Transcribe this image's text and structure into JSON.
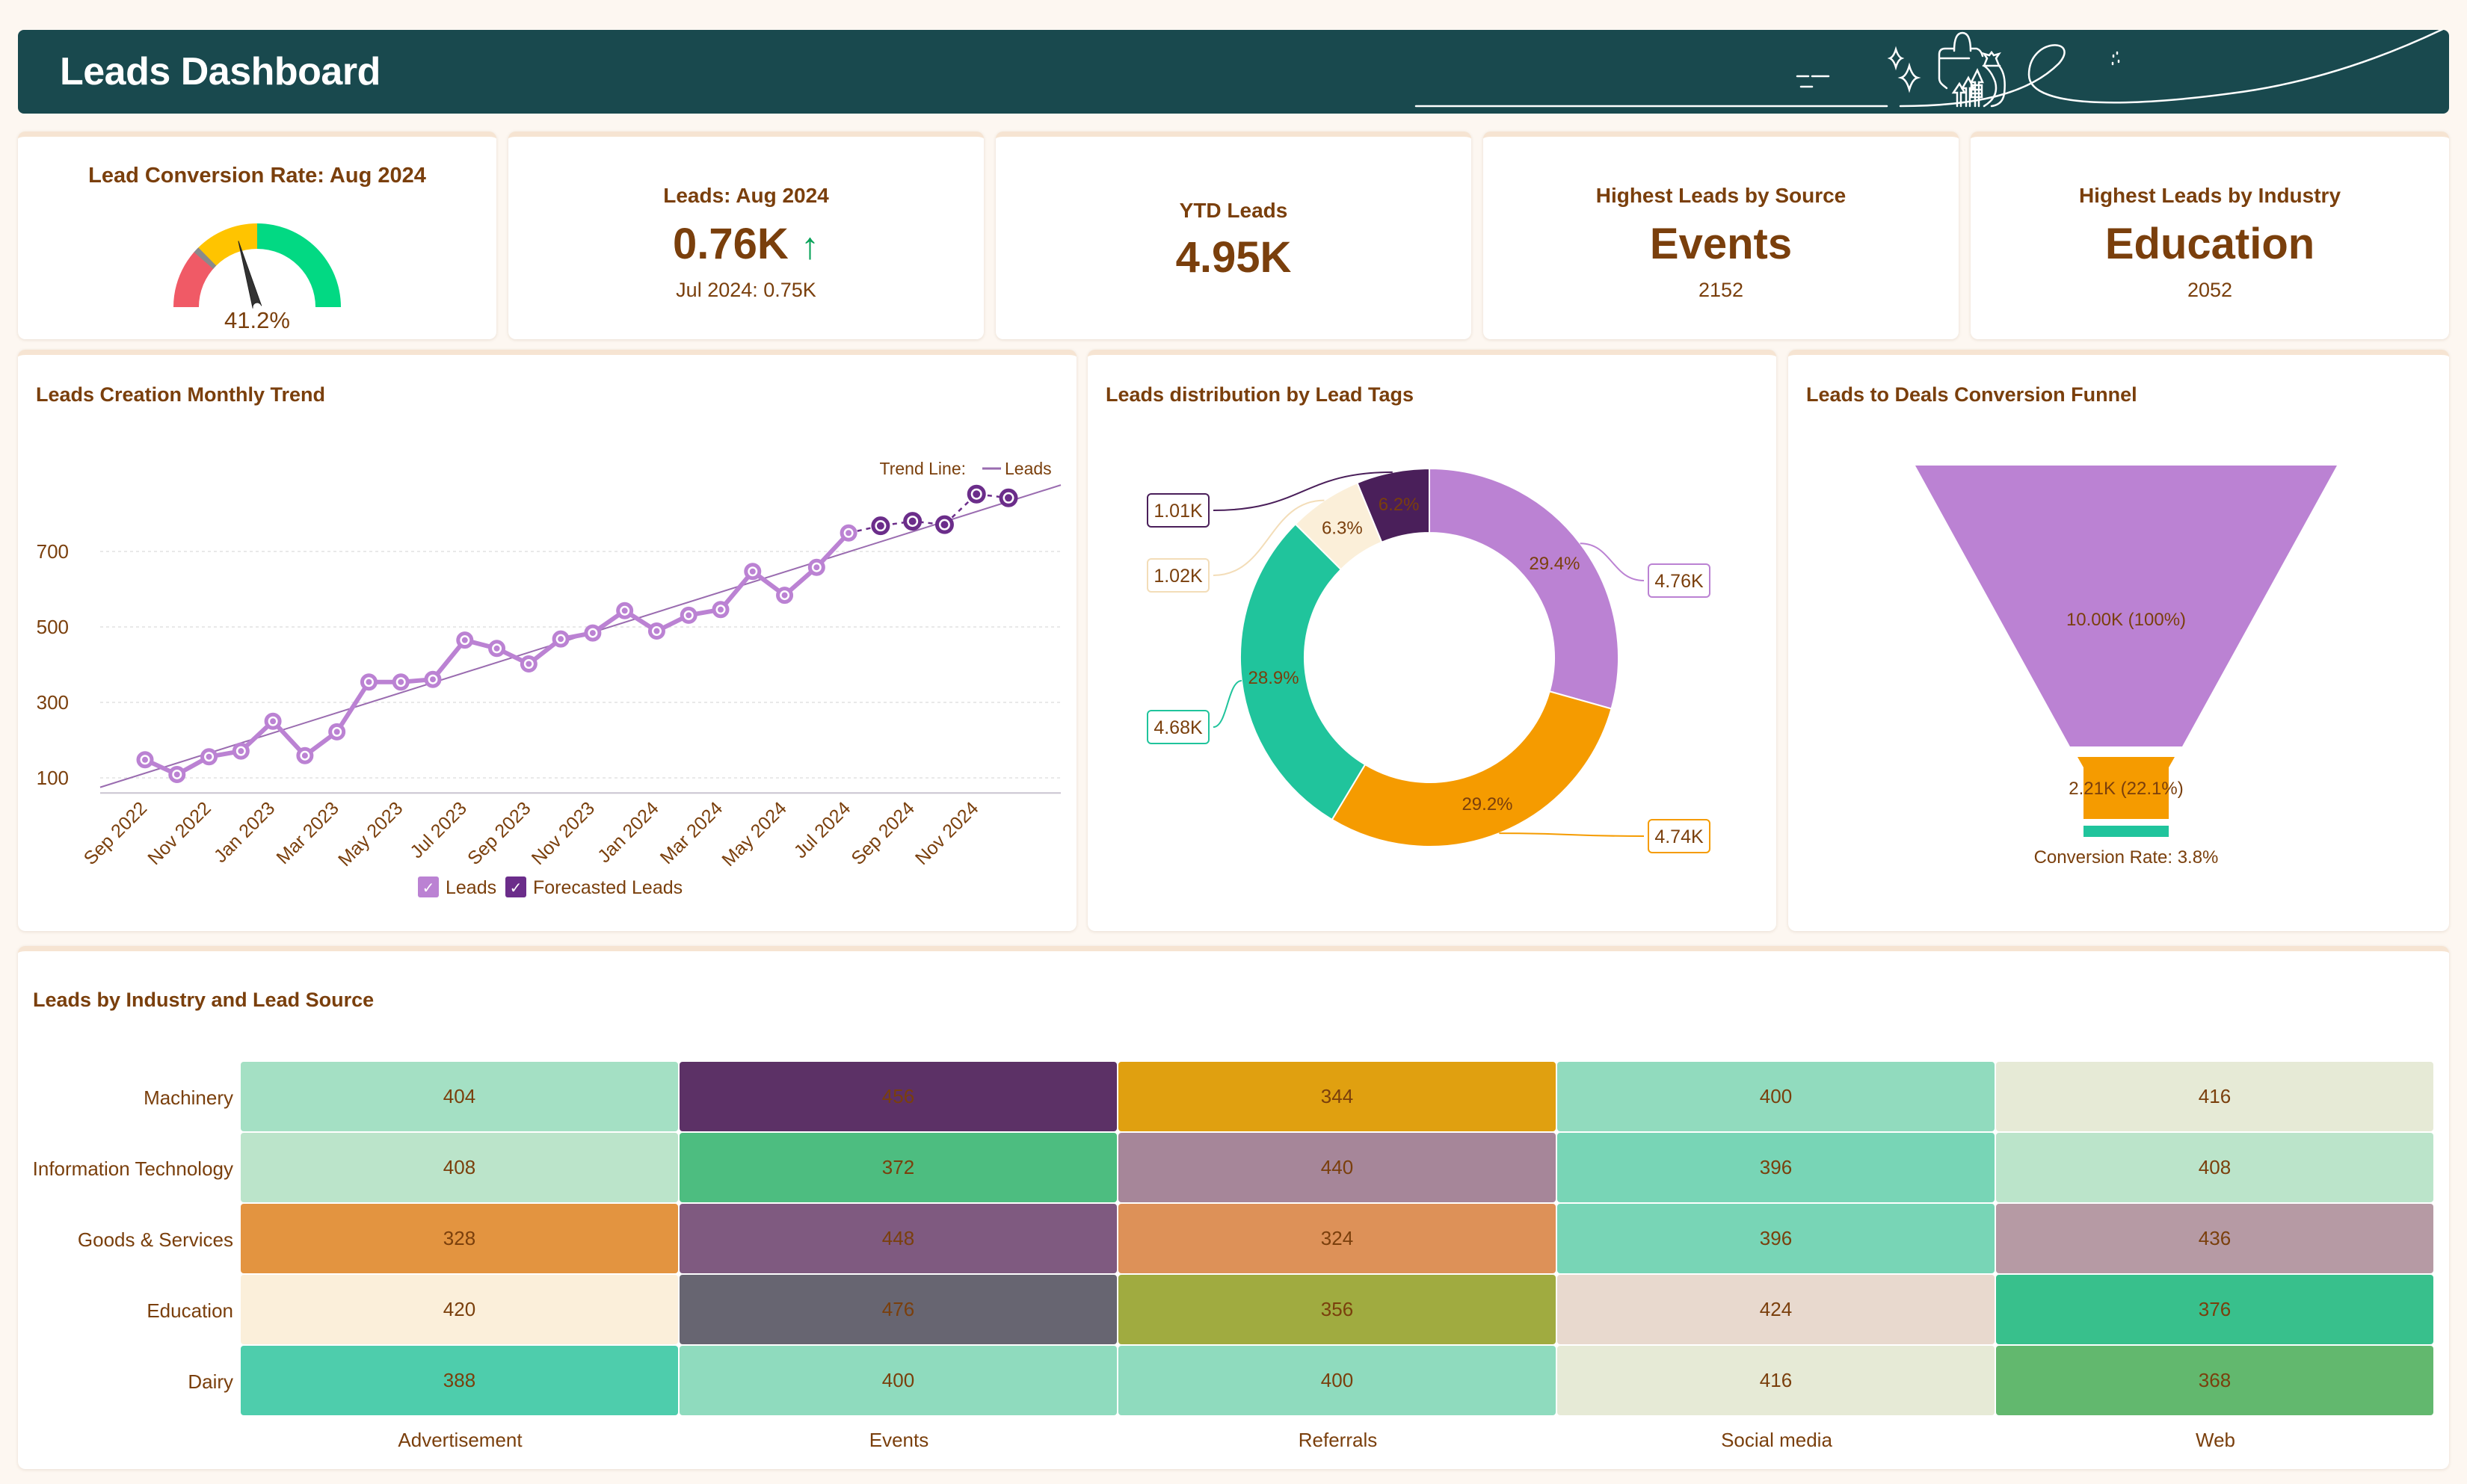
{
  "header": {
    "title": "Leads Dashboard"
  },
  "kpis": {
    "conversion": {
      "title": "Lead Conversion Rate: Aug 2024",
      "value": "41.2%",
      "gauge_value": 41.2,
      "gauge_bands": [
        {
          "from": 0,
          "to": 25,
          "color": "#f05a66"
        },
        {
          "from": 25,
          "to": 50,
          "color": "#ffc400"
        },
        {
          "from": 50,
          "to": 100,
          "color": "#02d983"
        }
      ],
      "target_marker": 24,
      "target_color": "#8a8a8a"
    },
    "leads_month": {
      "title": "Leads: Aug 2024",
      "value": "0.76K",
      "trend_icon": "arrow-up-icon",
      "trend_glyph": "↑",
      "comparison": "Jul 2024: 0.75K"
    },
    "ytd": {
      "title": "YTD Leads",
      "value": "4.95K"
    },
    "by_source": {
      "title": "Highest Leads by Source",
      "value": "Events",
      "sub": "2152"
    },
    "by_industry": {
      "title": "Highest Leads by Industry",
      "value": "Education",
      "sub": "2052"
    }
  },
  "panels": {
    "trend": {
      "title": "Leads Creation Monthly Trend"
    },
    "tags": {
      "title": "Leads distribution by Lead Tags"
    },
    "funnel": {
      "title": "Leads to Deals Conversion Funnel"
    },
    "heatmap": {
      "title": "Leads by Industry and Lead Source"
    }
  },
  "colors": {
    "leads": "#bb82d3",
    "forecast": "#6b2d8a",
    "trend": "#9a6cb0",
    "text": "#7a3f0c",
    "header_bg": "#19494e"
  },
  "chart_data": [
    {
      "type": "line",
      "title": "Leads Creation Monthly Trend",
      "xlabel": "",
      "ylabel": "",
      "ylim": [
        40,
        900
      ],
      "yticks": [
        100,
        300,
        500,
        700
      ],
      "grid": true,
      "x": [
        "Sep 2022",
        "Oct 2022",
        "Nov 2022",
        "Dec 2022",
        "Jan 2023",
        "Feb 2023",
        "Mar 2023",
        "Apr 2023",
        "May 2023",
        "Jun 2023",
        "Jul 2023",
        "Aug 2023",
        "Sep 2023",
        "Oct 2023",
        "Nov 2023",
        "Dec 2023",
        "Jan 2024",
        "Feb 2024",
        "Mar 2024",
        "Apr 2024",
        "May 2024",
        "Jun 2024",
        "Jul 2024",
        "Aug 2024",
        "Sep 2024",
        "Oct 2024",
        "Nov 2024",
        "Dec 2024"
      ],
      "xtick_labels": [
        "Sep 2022",
        "Nov 2022",
        "Jan 2023",
        "Mar 2023",
        "May 2023",
        "Jul 2023",
        "Sep 2023",
        "Nov 2023",
        "Jan 2024",
        "Mar 2024",
        "May 2024",
        "Jul 2024",
        "Sep 2024",
        "Nov 2024"
      ],
      "series": [
        {
          "name": "Leads",
          "values": [
            148,
            109,
            156,
            171,
            250,
            159,
            222,
            354,
            354,
            361,
            465,
            443,
            402,
            468,
            484,
            543,
            489,
            531,
            546,
            647,
            584,
            658,
            749,
            null,
            null,
            null,
            null,
            null
          ]
        },
        {
          "name": "Forecasted Leads",
          "values": [
            null,
            null,
            null,
            null,
            null,
            null,
            null,
            null,
            null,
            null,
            null,
            null,
            null,
            null,
            null,
            null,
            null,
            null,
            null,
            null,
            null,
            null,
            749,
            768,
            780,
            771,
            852,
            842
          ]
        }
      ],
      "trend_line": {
        "label": "Trend Line:",
        "series": "Leads",
        "start": 75,
        "end": 876
      },
      "legend": [
        "Leads",
        "Forecasted Leads"
      ],
      "legend_position": "bottom"
    },
    {
      "type": "pie",
      "title": "Leads distribution by Lead Tags",
      "donut": true,
      "slices": [
        {
          "value_label": "4.76K",
          "value": 4760,
          "percent": 29.4,
          "color": "#bb82d3"
        },
        {
          "value_label": "4.74K",
          "value": 4740,
          "percent": 29.2,
          "color": "#f59b00"
        },
        {
          "value_label": "4.68K",
          "value": 4680,
          "percent": 28.9,
          "color": "#20c49c"
        },
        {
          "value_label": "1.02K",
          "value": 1020,
          "percent": 6.3,
          "color": "#fbefd9"
        },
        {
          "value_label": "1.01K",
          "value": 1010,
          "percent": 6.2,
          "color": "#4a1f5a"
        }
      ]
    },
    {
      "type": "bar",
      "subtype": "funnel",
      "title": "Leads to Deals Conversion Funnel",
      "stages": [
        {
          "label": "10.00K (100%)",
          "value": 10000,
          "percent": 100,
          "color": "#bb82d3"
        },
        {
          "label": "2.21K (22.1%)",
          "value": 2210,
          "percent": 22.1,
          "color": "#f59b00"
        },
        {
          "label": "",
          "value": 380,
          "percent": 3.8,
          "color": "#20c49c"
        }
      ],
      "footer": "Conversion Rate: 3.8%"
    },
    {
      "type": "heatmap",
      "title": "Leads by Industry and Lead Source",
      "rows": [
        "Machinery",
        "Information Technology",
        "Goods & Services",
        "Education",
        "Dairy"
      ],
      "columns": [
        "Advertisement",
        "Events",
        "Referrals",
        "Social media",
        "Web"
      ],
      "values": [
        [
          404,
          456,
          344,
          400,
          416
        ],
        [
          408,
          372,
          440,
          396,
          408
        ],
        [
          328,
          448,
          324,
          396,
          436
        ],
        [
          420,
          476,
          356,
          424,
          376
        ],
        [
          388,
          400,
          400,
          416,
          368
        ]
      ],
      "cell_colors": [
        [
          "#a4e0c4",
          "#5c3166",
          "#e0a010",
          "#91dbbe",
          "#e6ead6"
        ],
        [
          "#bbe4ca",
          "#4dbd80",
          "#a68699",
          "#78d5b6",
          "#bbe4ca"
        ],
        [
          "#e39440",
          "#7f5a80",
          "#dd9158",
          "#78d5b6",
          "#b69aa4"
        ],
        [
          "#fbefda",
          "#676571",
          "#a0ab40",
          "#e8d9ce",
          "#38c08c"
        ],
        [
          "#4ecdac",
          "#8fdbbe",
          "#8fdbbe",
          "#e6ead6",
          "#62b86e"
        ]
      ]
    }
  ]
}
